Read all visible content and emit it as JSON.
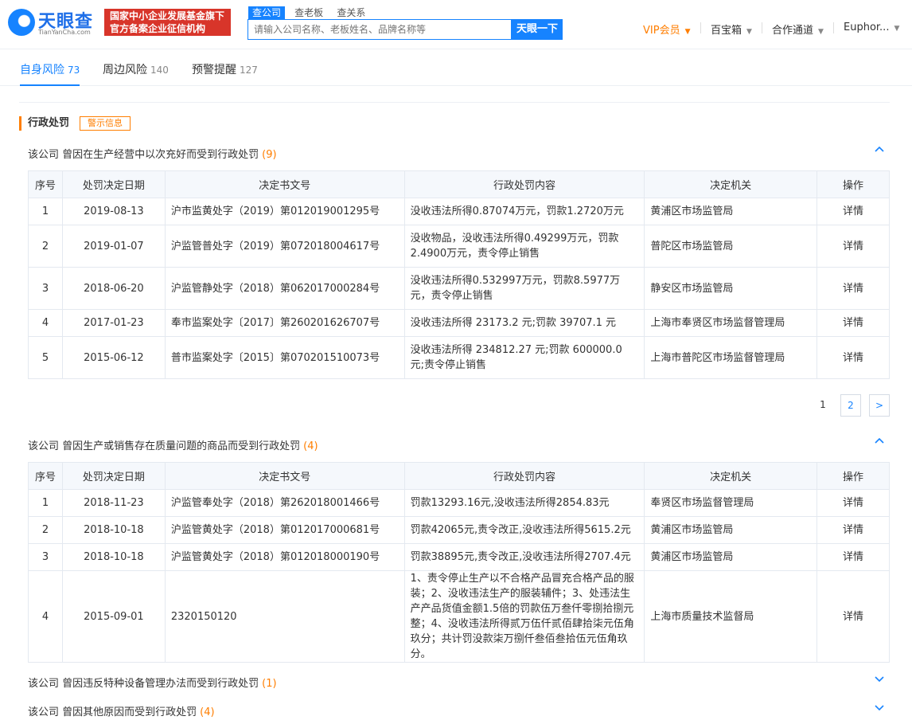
{
  "header": {
    "logo_text": "天眼查",
    "logo_sub": "TianYanCha.com",
    "badge_line1": "国家中小企业发展基金旗下",
    "badge_line2": "官方备案企业征信机构",
    "search_tabs": [
      "查公司",
      "查老板",
      "查关系"
    ],
    "search_placeholder": "请输入公司名称、老板姓名、品牌名称等",
    "search_button": "天眼一下",
    "nav": {
      "vip": "VIP会员",
      "tools": "百宝箱",
      "cooperate": "合作通道",
      "user": "Euphor..."
    },
    "colors": {
      "brand": "#1683ff",
      "vip": "#ff7e00",
      "badge": "#d8352a"
    }
  },
  "risk_tabs": [
    {
      "label": "自身风险",
      "count": "73"
    },
    {
      "label": "周边风险",
      "count": "140"
    },
    {
      "label": "预警提醒",
      "count": "127"
    }
  ],
  "section": {
    "title": "行政处罚",
    "tag": "警示信息"
  },
  "columns": [
    "序号",
    "处罚决定日期",
    "决定书文号",
    "行政处罚内容",
    "决定机关",
    "操作"
  ],
  "groups": [
    {
      "prefix": "该公司",
      "title": "曾因在生产经营中以次充好而受到行政处罚",
      "count": "(9)",
      "rows": [
        [
          "1",
          "2019-08-13",
          "沪市监黄处字（2019）第012019001295号",
          "没收违法所得0.87074万元，罚款1.2720万元",
          "黄浦区市场监管局",
          "详情"
        ],
        [
          "2",
          "2019-01-07",
          "沪监管普处字（2019）第072018004617号",
          "没收物品，没收违法所得0.49299万元，罚款2.4900万元，责令停止销售",
          "普陀区市场监管局",
          "详情"
        ],
        [
          "3",
          "2018-06-20",
          "沪监管静处字（2018）第062017000284号",
          "没收违法所得0.532997万元，罚款8.5977万元，责令停止销售",
          "静安区市场监管局",
          "详情"
        ],
        [
          "4",
          "2017-01-23",
          "奉市监案处字〔2017〕第260201626707号",
          "没收违法所得 23173.2 元;罚款 39707.1 元",
          "上海市奉贤区市场监督管理局",
          "详情"
        ],
        [
          "5",
          "2015-06-12",
          "普市监案处字〔2015〕第070201510073号",
          "没收违法所得 234812.27 元;罚款 600000.0 元;责令停止销售",
          "上海市普陀区市场监督管理局",
          "详情"
        ]
      ],
      "pager": [
        "1",
        "2",
        ">"
      ]
    },
    {
      "prefix": "该公司",
      "title": "曾因生产或销售存在质量问题的商品而受到行政处罚",
      "count": "(4)",
      "rows": [
        [
          "1",
          "2018-11-23",
          "沪监管奉处字（2018）第262018001466号",
          "罚款13293.16元,没收违法所得2854.83元",
          "奉贤区市场监督管理局",
          "详情"
        ],
        [
          "2",
          "2018-10-18",
          "沪监管黄处字（2018）第012017000681号",
          "罚款42065元,责令改正,没收违法所得5615.2元",
          "黄浦区市场监管局",
          "详情"
        ],
        [
          "3",
          "2018-10-18",
          "沪监管黄处字（2018）第012018000190号",
          "罚款38895元,责令改正,没收违法所得2707.4元",
          "黄浦区市场监管局",
          "详情"
        ],
        [
          "4",
          "2015-09-01",
          "2320150120",
          "1、责令停止生产以不合格产品冒充合格产品的服装；2、没收违法生产的服装辅件；3、处违法生产产品货值金额1.5倍的罚款伍万叁仟零捌拾捌元整；4、没收违法所得贰万伍仟贰佰肆拾柒元伍角玖分；共计罚没款柒万捌仟叁佰叁拾伍元伍角玖分。",
          "上海市质量技术监督局",
          "详情"
        ]
      ]
    },
    {
      "prefix": "该公司",
      "title": "曾因违反特种设备管理办法而受到行政处罚",
      "count": "(1)"
    },
    {
      "prefix": "该公司",
      "title": "曾因其他原因而受到行政处罚",
      "count": "(4)"
    }
  ]
}
